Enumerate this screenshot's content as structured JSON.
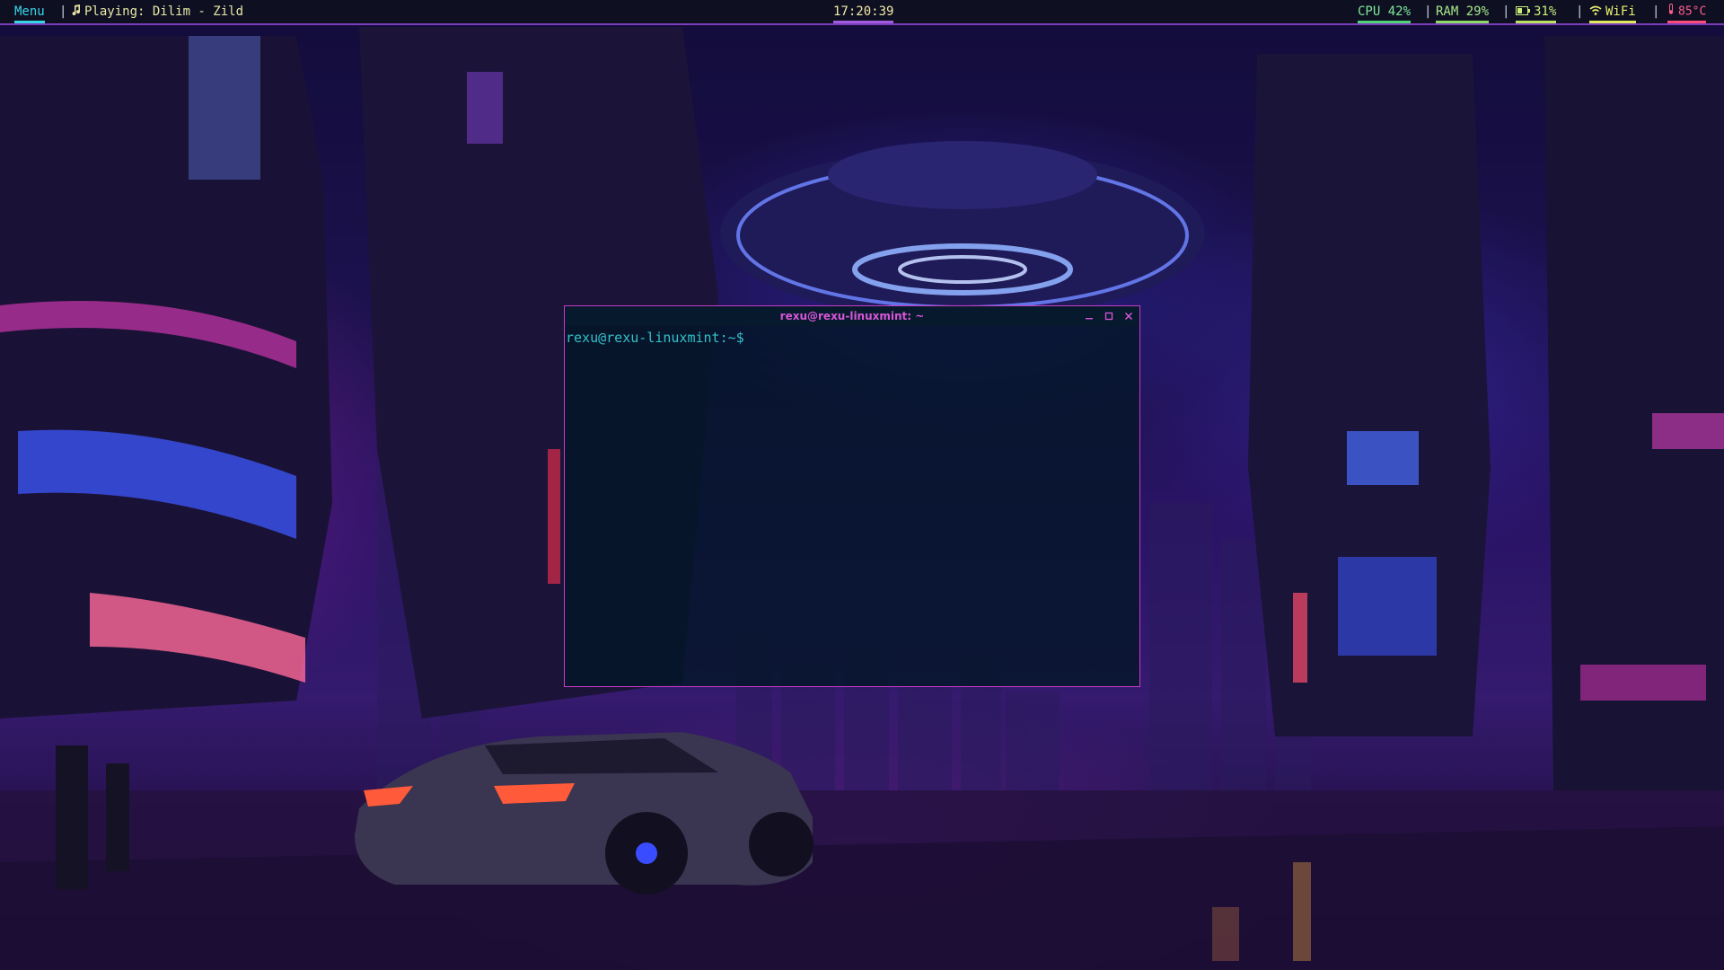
{
  "topbar": {
    "menu_label": "Menu",
    "separator": "|",
    "now_playing": "Playing: Dilim - Zild",
    "clock": "17:20:39",
    "cpu": "CPU 42%",
    "ram": "RAM 29%",
    "battery": "31%",
    "wifi": "WiFi",
    "temperature": "85°C",
    "icons": {
      "music": "music-note-icon",
      "battery": "battery-icon",
      "wifi": "wifi-icon",
      "temperature": "thermometer-icon"
    },
    "colors": {
      "menu": "#36d6e7",
      "accent_border": "#7a3fb8",
      "cpu": "#7ee89a",
      "temperature": "#ff5b8a"
    }
  },
  "terminal": {
    "title": "rexu@rexu-linuxmint: ~",
    "prompt": "rexu@rexu-linuxmint:~$",
    "controls": [
      "minimize",
      "maximize",
      "close"
    ],
    "colors": {
      "title": "#d856d8",
      "prompt": "#33c1c9",
      "border": "#c93ac9"
    }
  }
}
